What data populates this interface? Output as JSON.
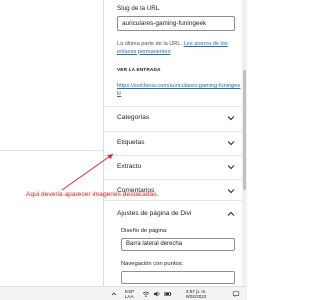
{
  "sidebar": {
    "slug_label": "Slug de la URL",
    "slug_value": "auriculares-gaming-funingeek",
    "slug_help_prefix": "La última parte de la URL. ",
    "slug_help_link": "Lee acerca de los enlaces permanentes",
    "view_entry_label": "VER LA ENTRADA",
    "permalink": "https://esicfania.com/auriculares-gaming-funingeek/",
    "panels": [
      {
        "title": "Categorías"
      },
      {
        "title": "Etiquetas"
      },
      {
        "title": "Extracto"
      },
      {
        "title": "Comentarios"
      }
    ],
    "divi": {
      "title": "Ajustes de página de Divi",
      "layout_label": "Diseño de página:",
      "layout_value": "Barra lateral derecha",
      "nav_label": "Navegación con puntos:"
    }
  },
  "annotation": {
    "text": "Aqui deveria aparecer imagenes destacadas.",
    "color": "#e02020"
  },
  "taskbar": {
    "lang_top": "ESP",
    "lang_bottom": "LAA",
    "time": "2:57 p. m.",
    "date": "9/02/2022",
    "icons": [
      "chevron-up-icon",
      "wifi-icon",
      "speaker-icon",
      "battery-icon",
      "notification-icon"
    ]
  },
  "colors": {
    "link": "#2271b1",
    "annotation": "#e02020",
    "border": "#8c8f94"
  }
}
